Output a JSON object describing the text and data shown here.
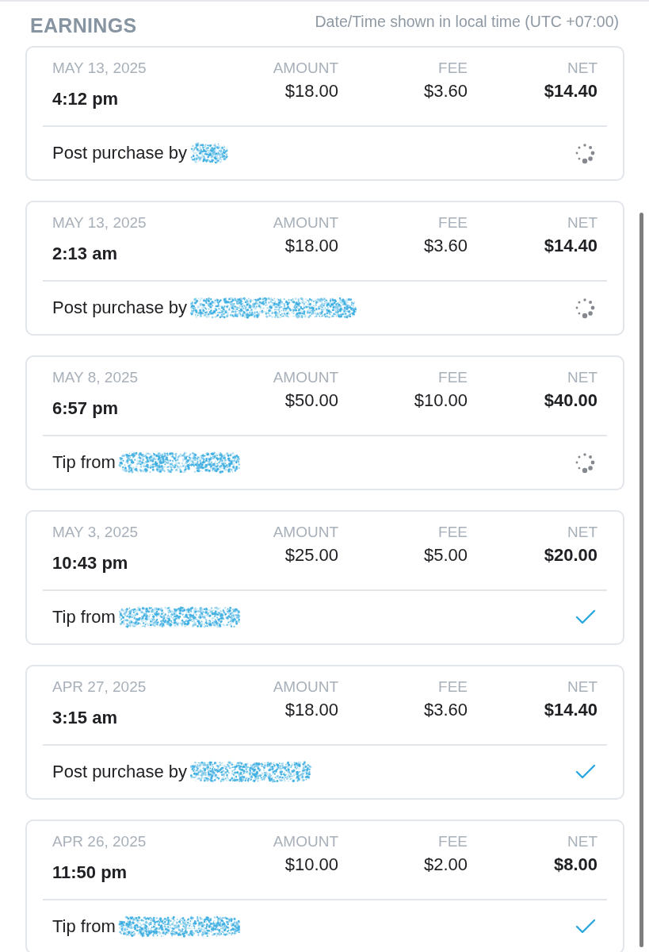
{
  "header": {
    "title": "EARNINGS",
    "timezone_note": "Date/Time shown in local time (UTC +07:00)"
  },
  "earnings": [
    {
      "kind": "pending",
      "date": "MAY 13, 2025",
      "time": "4:12 pm",
      "amount_label": "AMOUNT",
      "amount": "$18.00",
      "fee_label": "FEE",
      "fee": "$3.60",
      "net_label": "NET",
      "net": "$14.40",
      "description": "Post purchase by",
      "redaction": {
        "kind": "short"
      }
    },
    {
      "kind": "pending",
      "date": "MAY 13, 2025",
      "time": "2:13 am",
      "amount_label": "AMOUNT",
      "amount": "$18.00",
      "fee_label": "FEE",
      "fee": "$3.60",
      "net_label": "NET",
      "net": "$14.40",
      "description": "Post purchase by",
      "redaction": {
        "kind": "long"
      }
    },
    {
      "kind": "pending",
      "date": "MAY 8, 2025",
      "time": "6:57 pm",
      "amount_label": "AMOUNT",
      "amount": "$50.00",
      "fee_label": "FEE",
      "fee": "$10.00",
      "net_label": "NET",
      "net": "$40.00",
      "description": "Tip from",
      "redaction": {
        "kind": "medium"
      }
    },
    {
      "kind": "completed",
      "date": "MAY 3, 2025",
      "time": "10:43 pm",
      "amount_label": "AMOUNT",
      "amount": "$25.00",
      "fee_label": "FEE",
      "fee": "$5.00",
      "net_label": "NET",
      "net": "$20.00",
      "description": "Tip from",
      "redaction": {
        "kind": "medium"
      }
    },
    {
      "kind": "completed",
      "date": "APR 27, 2025",
      "time": "3:15 am",
      "amount_label": "AMOUNT",
      "amount": "$18.00",
      "fee_label": "FEE",
      "fee": "$3.60",
      "net_label": "NET",
      "net": "$14.40",
      "description": "Post purchase by",
      "redaction": {
        "kind": "medium"
      }
    },
    {
      "kind": "completed",
      "date": "APR 26, 2025",
      "time": "11:50 pm",
      "amount_label": "AMOUNT",
      "amount": "$10.00",
      "fee_label": "FEE",
      "fee": "$2.00",
      "net_label": "NET",
      "net": "$8.00",
      "description": "Tip from",
      "redaction": {
        "kind": "medium"
      }
    }
  ]
}
